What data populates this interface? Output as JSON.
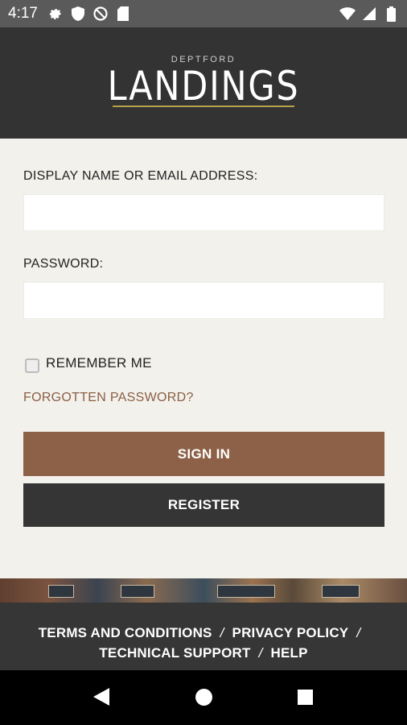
{
  "status_bar": {
    "time": "4:17",
    "left_icons": [
      "settings-icon",
      "shield-icon",
      "do-not-disturb-icon",
      "sd-card-icon"
    ],
    "right_icons": [
      "wifi-icon",
      "signal-icon",
      "battery-icon"
    ]
  },
  "header": {
    "logo_small": "DEPTFORD",
    "logo_main": "LANDINGS",
    "accent": "#b8a24a"
  },
  "form": {
    "email_label": "DISPLAY NAME OR EMAIL ADDRESS:",
    "email_value": "",
    "password_label": "PASSWORD:",
    "password_value": "",
    "remember_label": "REMEMBER ME",
    "remember_checked": false,
    "forgot_link": "FORGOTTEN PASSWORD?",
    "signin_label": "SIGN IN",
    "register_label": "REGISTER"
  },
  "footer": {
    "links": [
      "TERMS AND CONDITIONS",
      "PRIVACY POLICY",
      "TECHNICAL SUPPORT",
      "HELP"
    ],
    "separator": "/"
  },
  "colors": {
    "brand_brown": "#8d6147",
    "link_brown": "#8a5e43",
    "dark": "#353535",
    "form_bg": "#f3f1ec"
  },
  "nav_bar": {
    "icons": [
      "back-icon",
      "home-icon",
      "recents-icon"
    ]
  }
}
